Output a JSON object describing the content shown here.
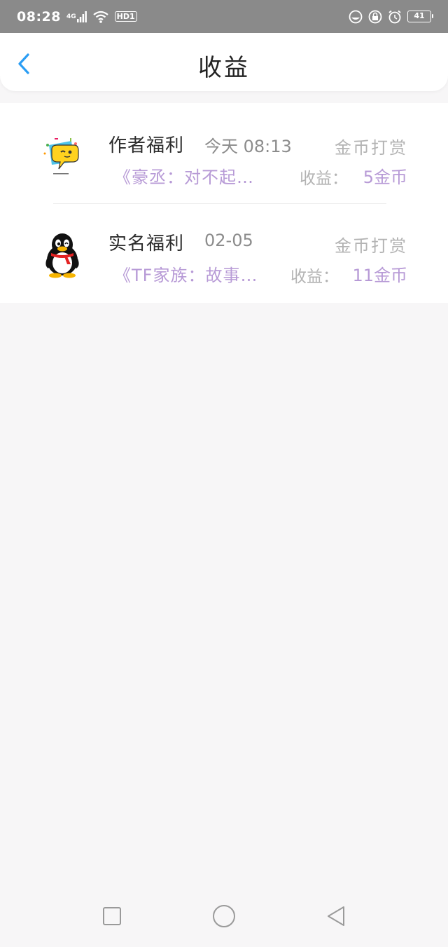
{
  "status_bar": {
    "time": "08:28",
    "network_label": "4G",
    "hd_label": "HD1",
    "battery": "41",
    "icons": [
      "signal-icon",
      "wifi-icon",
      "hd-icon",
      "do-not-disturb-icon",
      "lock-icon",
      "alarm-icon",
      "battery-icon"
    ]
  },
  "header": {
    "title": "收益",
    "back_icon": "chevron-left-icon"
  },
  "items": [
    {
      "avatar_icon": "chat-bubble-face-icon",
      "title": "作者福利",
      "time": "今天 08:13",
      "type": "金币打赏",
      "book": "《豪丞：对不起…",
      "earn_label": "收益：",
      "earn_value": "5金币"
    },
    {
      "avatar_icon": "penguin-icon",
      "title": "实名福利",
      "time": "02-05",
      "type": "金币打赏",
      "book": "《TF家族：故事…",
      "earn_label": "收益：",
      "earn_value": "11金币"
    }
  ],
  "colors": {
    "status_bar_bg": "#8a8a8a",
    "accent_blue": "#2a9df4",
    "purple_text": "#b79ad6",
    "gray_text": "#b3b3b3",
    "page_bg": "#f7f6f7"
  },
  "navbar": {
    "icons": [
      "recent-apps-icon",
      "home-icon",
      "back-icon"
    ]
  }
}
